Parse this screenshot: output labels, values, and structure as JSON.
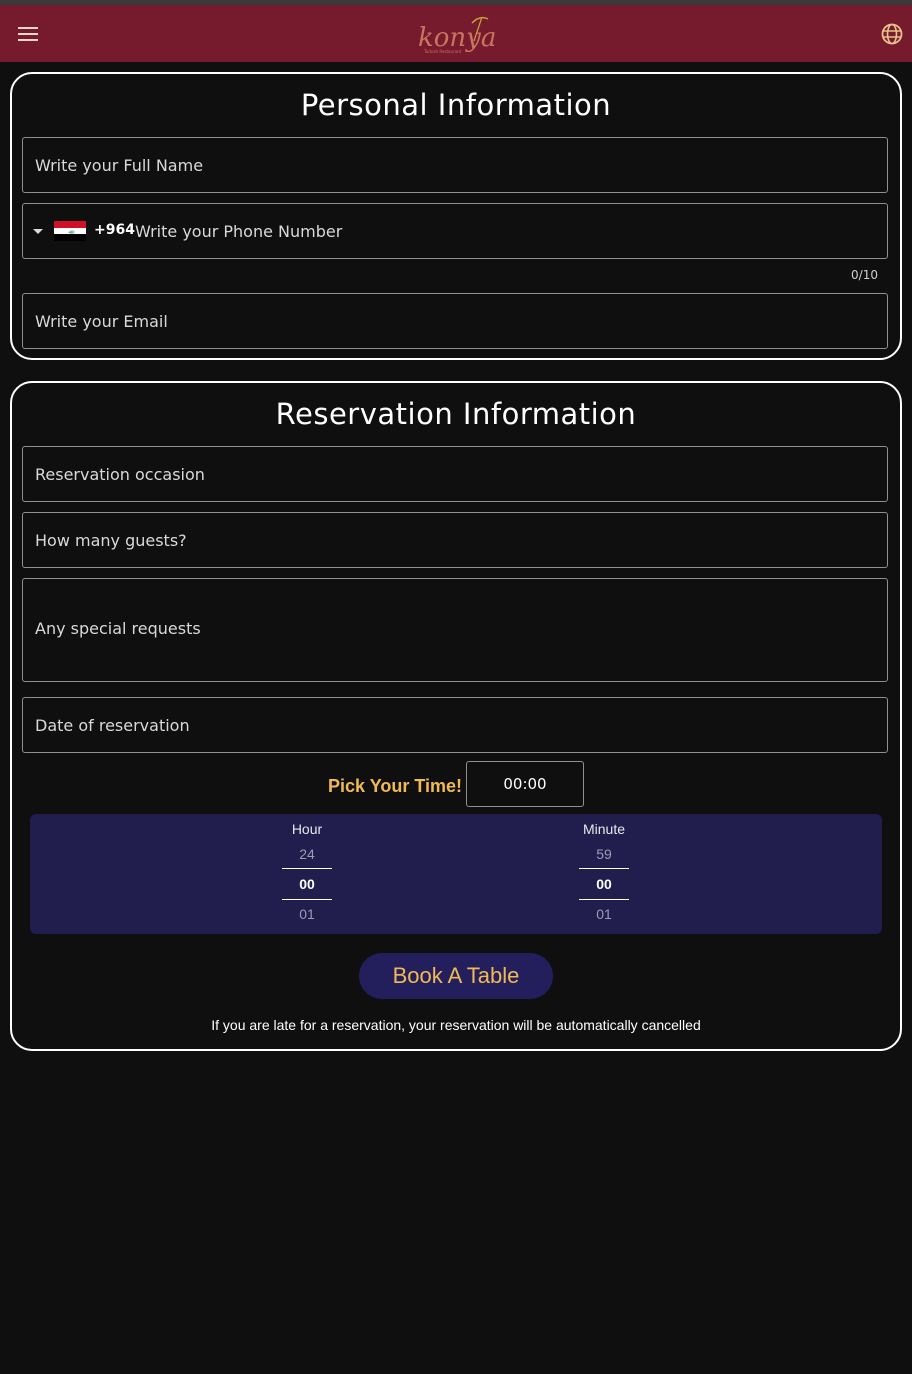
{
  "brand": {
    "logo_text": "konya",
    "logo_subtext": "Turkish Restaurant"
  },
  "colors": {
    "appbar": "#761a2d",
    "accent_gold": "#f0b955",
    "picker_bg": "#211e4d",
    "button_bg": "#231f5c"
  },
  "icons": {
    "menu": "hamburger-menu-icon",
    "language": "globe-icon",
    "dropdown": "caret-down-icon",
    "flag": "iraq-flag-icon"
  },
  "personal": {
    "title": "Personal Information",
    "full_name_placeholder": "Write your Full Name",
    "phone": {
      "dial_code": "+964",
      "placeholder": "Write your Phone Number",
      "counter": "0/10"
    },
    "email_placeholder": "Write your Email"
  },
  "reservation": {
    "title": "Reservation Information",
    "occasion_placeholder": "Reservation occasion",
    "guests_placeholder": "How many guests?",
    "requests_placeholder": "Any special requests",
    "date_placeholder": "Date of reservation",
    "time_label": "Pick Your Time!",
    "time_value": "00:00",
    "picker": {
      "hour": {
        "label": "Hour",
        "prev": "24",
        "current": "00",
        "next": "01"
      },
      "minute": {
        "label": "Minute",
        "prev": "59",
        "current": "00",
        "next": "01"
      }
    },
    "book_label": "Book A Table",
    "notice": "If you are late for a reservation, your reservation will be automatically cancelled"
  }
}
